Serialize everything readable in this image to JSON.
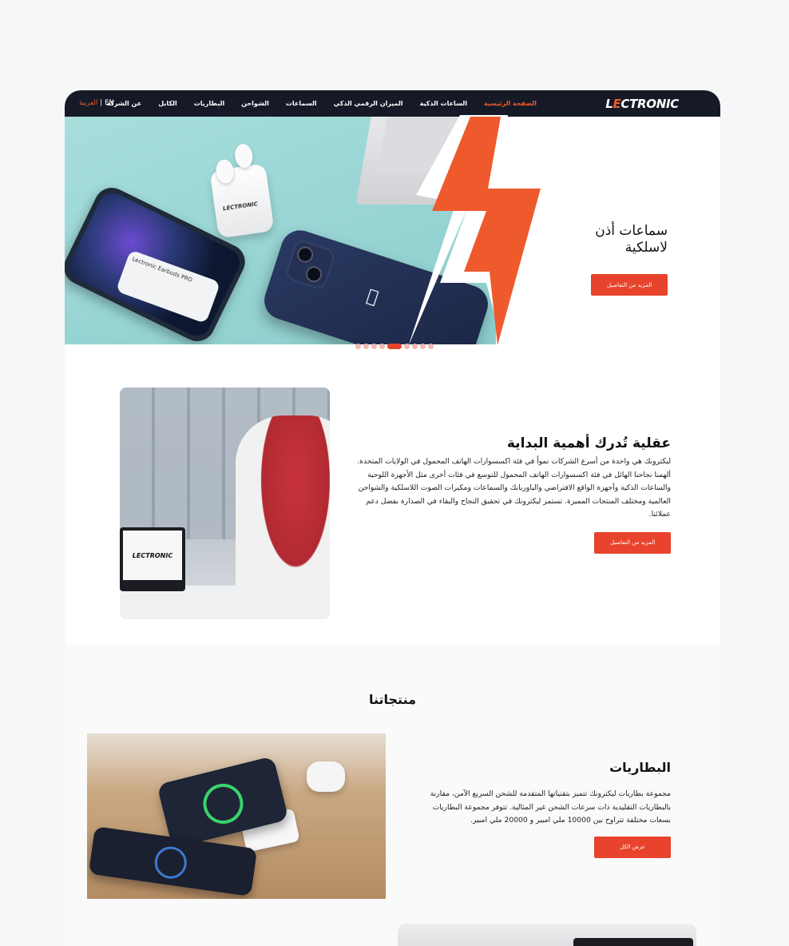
{
  "nav": {
    "logo_prefix": "L",
    "logo_mark": "E",
    "logo_suffix": "CTRONIC",
    "menu": [
      {
        "label": "الصفحة الرئيسية",
        "active": true
      },
      {
        "label": "الساعات الذكية"
      },
      {
        "label": "الميزان الرقمي الذكي"
      },
      {
        "label": "السماعات"
      },
      {
        "label": "الشواحن"
      },
      {
        "label": "البطاريات"
      },
      {
        "label": "الكابل"
      },
      {
        "label": "عن الشركة"
      }
    ],
    "lang_en": "EN",
    "lang_sep": "|",
    "lang_ar": "العربية"
  },
  "hero": {
    "title_line1": "سماعات أذن",
    "title_line2": "لاسلكية",
    "button": "المزيد من التفاصيل",
    "card_text": "Lectronic Earbuds PRO",
    "case_brand": "LECTRONIC",
    "slides_total": 9,
    "slide_active": 5
  },
  "about": {
    "title": "عقلية تُدرك أهمية البداية",
    "body": "ليكترونك هي واحدة من أسرع الشركات نمواً في فئة اكسسوارات الهاتف المحمول في الولايات المتحدة. ألهمنا نجاحنا الهائل في فئة اكسسوارات الهاتف المحمول للتوسع في فئات أخرى مثل الأجهزة اللوحية والساعات الذكية وأجهزة الواقع الافتراضي والباوربانك والسماعات ومكبرات الصوت اللاسلكية والشواحن العالمية ومختلف المنتجات المميزة. تستمر ليكترونك في تحقيق النجاح والبقاء في الصدارة بفضل دعم عملائنا.",
    "button": "المزيد من التفاصيل",
    "laptop_logo": "LECTRONIC"
  },
  "products": {
    "section_title": "منتجاتنا",
    "items": [
      {
        "title": "البطاريات",
        "body": "مجموعة بطاريات ليكترونك تتميز بتقنياتها المتقدمة للشحن السريع الآمن، مقارنة بالبطاريات التقليدية ذات سرعات الشحن غير المثالية. تتوفر مجموعة البطاريات بسعات مختلفة تتراوح بين 10000 ملي امبير و 20000 ملي امبير.",
        "button": "عرض الكل"
      }
    ]
  },
  "colors": {
    "accent": "#e8432c",
    "nav_bg": "#161a26",
    "bolt": "#ef5a2c"
  }
}
